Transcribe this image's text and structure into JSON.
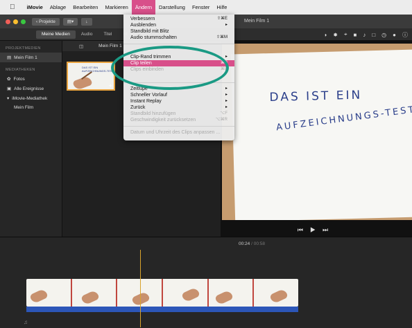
{
  "menubar": {
    "app_name": "iMovie",
    "items": [
      "Ablage",
      "Bearbeiten",
      "Markieren",
      "Ändern",
      "Darstellung",
      "Fenster",
      "Hilfe"
    ],
    "active_index": 3
  },
  "toolbar": {
    "projects_button": "Projekte",
    "project_title": "Mein Film 1"
  },
  "tabs": {
    "my_media": "Meine Medien",
    "audio": "Audio",
    "titles": "Titel",
    "backgrounds": "Hi"
  },
  "sidebar": {
    "project_media_header": "PROJEKTMEDIEN",
    "project_item": "Mein Film 1",
    "libraries_header": "MEDIATHEKEN",
    "photos": "Fotos",
    "all_events": "Alle Ereignisse",
    "library": "iMovie-Mediathek",
    "library_child": "Mein Film"
  },
  "browser": {
    "header_label": "Mein Film 1"
  },
  "viewer": {
    "line1": "DAS IST EIN",
    "line2": "AUFZEICHNUNGS-TEST"
  },
  "thumbnail_text": {
    "line1": "DAS IST EIN",
    "line2": "AUFZEICHNUNGS-TEST"
  },
  "timeline": {
    "current_time": "00:24",
    "separator": "/",
    "total_time": "00:58"
  },
  "menu": {
    "items": [
      {
        "label": "Verbessern",
        "shortcut": "⇧⌘E",
        "disabled": false
      },
      {
        "label": "Ausblenden",
        "shortcut": "▸",
        "disabled": false
      },
      {
        "label": "Standbild mit Blitz",
        "shortcut": "",
        "disabled": false
      },
      {
        "label": "Audio stummschalten",
        "shortcut": "⇧⌘M",
        "disabled": false
      },
      {
        "label": "Clip-Rand trimmen",
        "shortcut": "▸",
        "disabled": false
      },
      {
        "label": "Clip teilen",
        "shortcut": "⌘B",
        "disabled": false,
        "highlighted": true
      },
      {
        "label": "Clips einbinden",
        "shortcut": "⌘B",
        "disabled": true
      },
      {
        "label": "Zeitlupe",
        "shortcut": "▸",
        "disabled": false
      },
      {
        "label": "Schneller Vorlauf",
        "shortcut": "▸",
        "disabled": false
      },
      {
        "label": "Instant Replay",
        "shortcut": "▸",
        "disabled": false
      },
      {
        "label": "Zurück",
        "shortcut": "▸",
        "disabled": false
      },
      {
        "label": "Standbild hinzufügen",
        "shortcut": "⌥F",
        "disabled": true
      },
      {
        "label": "Geschwindigkeit zurücksetzen",
        "shortcut": "⌥⌘R",
        "disabled": true
      },
      {
        "label": "Datum und Uhrzeit des Clips anpassen ...",
        "shortcut": "",
        "disabled": true
      }
    ]
  },
  "colors": {
    "menu_highlight": "#d84f8a",
    "annotation_ring": "#1a9a84",
    "selection_border": "#e9a43f",
    "audio_track": "#2c56b8"
  }
}
